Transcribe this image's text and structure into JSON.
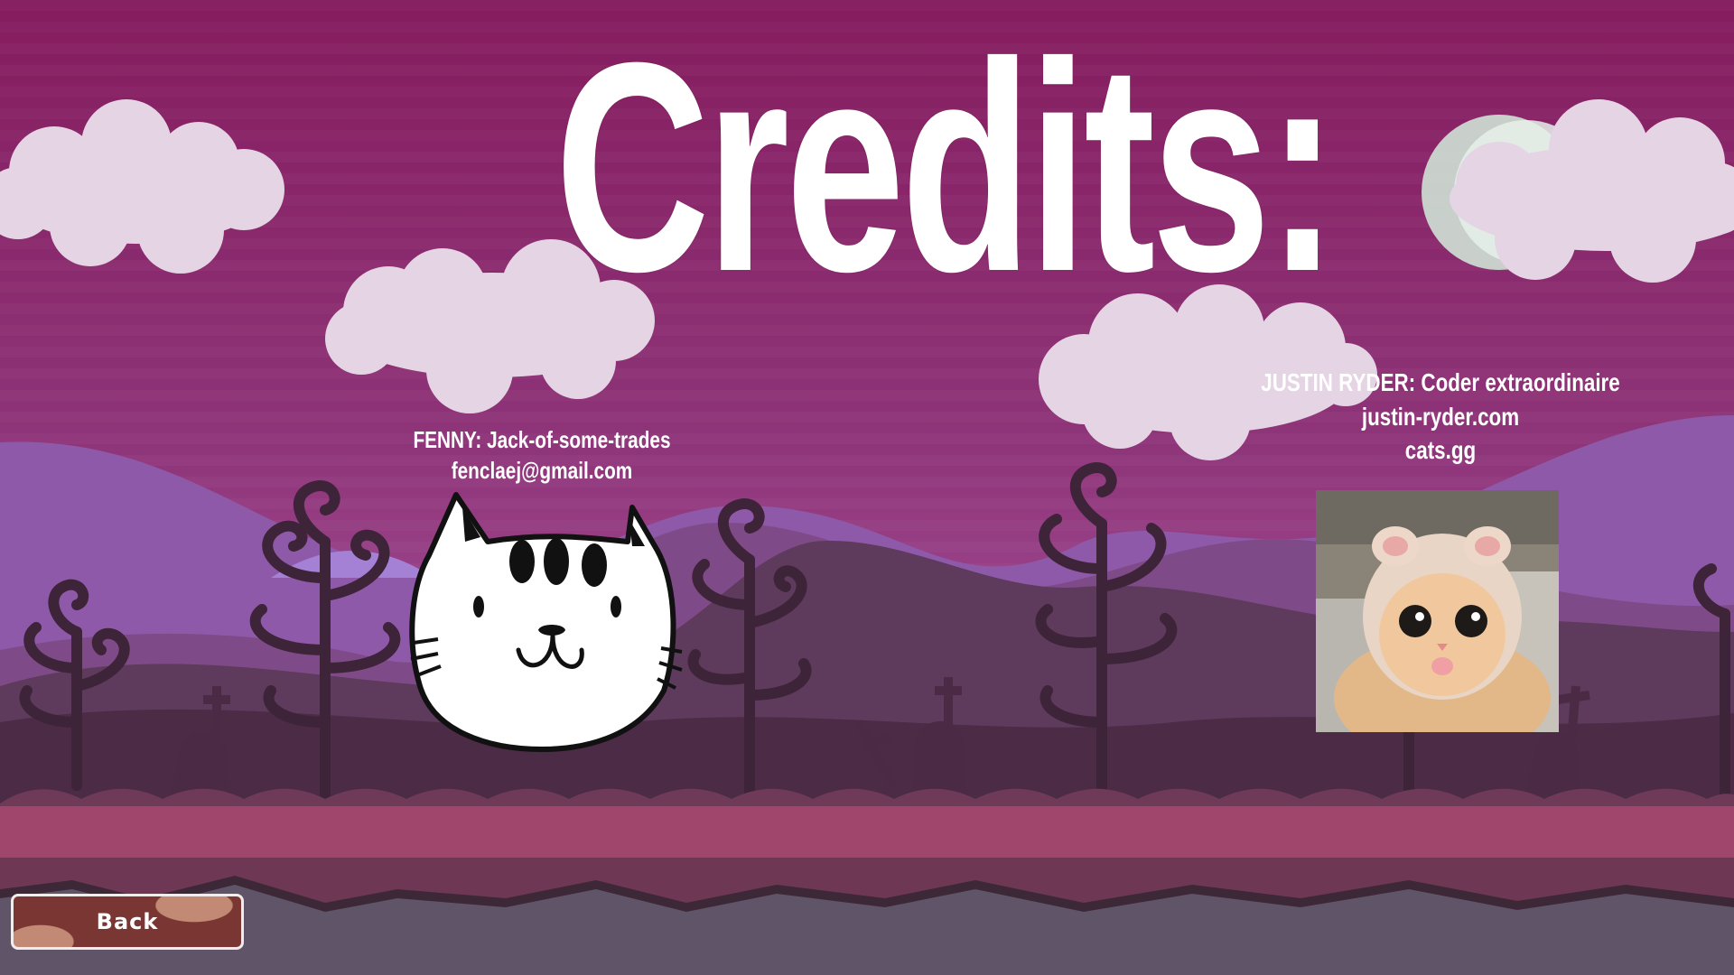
{
  "screen": {
    "title": "Credits:"
  },
  "credits": [
    {
      "role_line": "FENNY: Jack-of-some-trades",
      "contact": "fenclaej@gmail.com"
    },
    {
      "role_line": "JUSTIN RYDER: Coder extraordinaire",
      "contact": "justin-ryder.com",
      "extra": "cats.gg"
    }
  ],
  "buttons": {
    "back_label": "Back"
  },
  "icons": {
    "fenny_avatar": "cartoon-cat-face-icon",
    "justin_avatar": "cat-photo"
  },
  "colors": {
    "sky_top": "#851c5e",
    "sky_bottom": "#a04a92",
    "cloud": "#e5d4e4",
    "moon": "#dfeee4",
    "ground_stripe": "#a0466c",
    "button_fill": "#7a3632",
    "text": "#ffffff"
  }
}
